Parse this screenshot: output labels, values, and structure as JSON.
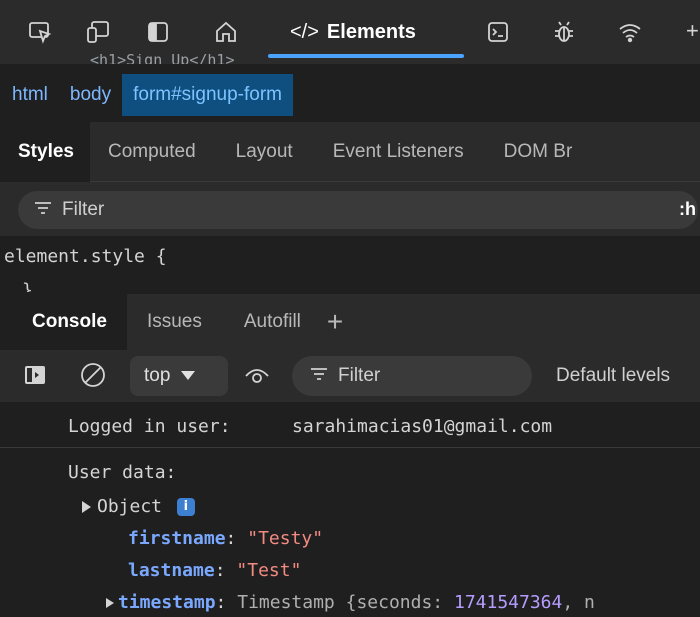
{
  "toolbar": {
    "elements_tab": "Elements",
    "cutoff_text": "<h1>Sign Up</h1>"
  },
  "breadcrumb": [
    "html",
    "body",
    "form#signup-form"
  ],
  "styles_tabs": [
    "Styles",
    "Computed",
    "Layout",
    "Event Listeners",
    "DOM Br"
  ],
  "styles_filter": {
    "placeholder": "Filter",
    "hov": ":h"
  },
  "element_style": {
    "selector": "element.style {",
    "close": "}"
  },
  "drawer_tabs": [
    "Console",
    "Issues",
    "Autofill"
  ],
  "console_toolbar": {
    "context": "top",
    "filter_placeholder": "Filter",
    "levels": "Default levels"
  },
  "console": {
    "logged_label": "Logged in user:",
    "logged_email": "sarahimacias01@gmail.com",
    "user_data": "User data:",
    "object_label": "Object",
    "info": "i",
    "firstname_key": "firstname",
    "firstname_val": "\"Testy\"",
    "lastname_key": "lastname",
    "lastname_val": "\"Test\"",
    "timestamp_key": "timestamp",
    "timestamp_type": "Timestamp {seconds: ",
    "timestamp_seconds": "1741547364",
    "timestamp_rest": ", n"
  },
  "colors": {
    "accent": "#4aa3ff",
    "selected_crumb": "#0e4f80"
  }
}
